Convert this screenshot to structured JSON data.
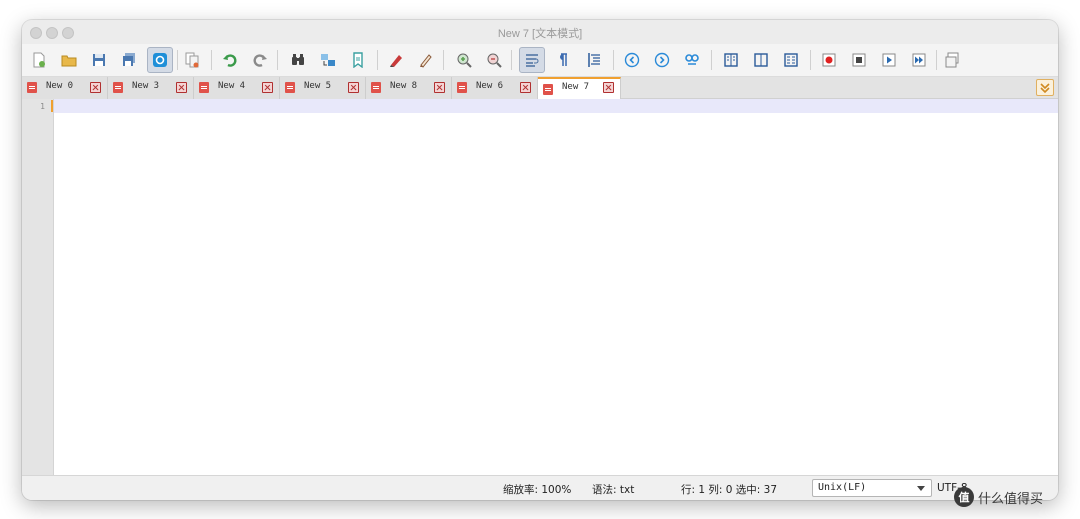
{
  "window": {
    "title": "New 7 [文本模式]"
  },
  "toolbar": {
    "buttons": [
      {
        "icon": "new-file-icon",
        "color": "#6ab04c"
      },
      {
        "icon": "open-folder-icon",
        "color": "#e8b84a"
      },
      {
        "icon": "save-icon",
        "color": "#4a78b0"
      },
      {
        "icon": "save-all-icon",
        "color": "#4a78b0"
      },
      {
        "icon": "toggle-active-icon",
        "color": "#1f8fd8",
        "active": true
      },
      {
        "icon": "copy-file-icon",
        "color": "#9a9a9a"
      },
      {
        "icon": "undo-icon",
        "color": "#3a9a4a"
      },
      {
        "icon": "redo-icon",
        "color": "#8a8a8a"
      },
      {
        "icon": "find-icon",
        "color": "#444444"
      },
      {
        "icon": "replace-icon",
        "color": "#3a88c8"
      },
      {
        "icon": "bookmark-icon",
        "color": "#3aa0a0"
      },
      {
        "icon": "highlight-icon",
        "color": "#c83a3a"
      },
      {
        "icon": "clear-highlight-icon",
        "color": "#8a5a3a"
      },
      {
        "icon": "zoom-in-icon",
        "color": "#5aa050"
      },
      {
        "icon": "zoom-out-icon",
        "color": "#c05050"
      },
      {
        "icon": "word-wrap-icon",
        "color": "#4a70a0",
        "active": true
      },
      {
        "icon": "show-symbols-icon",
        "color": "#3a6ab0"
      },
      {
        "icon": "indent-guide-icon",
        "color": "#2a5a9a"
      },
      {
        "icon": "previous-icon",
        "color": "#2a8ad8"
      },
      {
        "icon": "next-icon",
        "color": "#2a8ad8"
      },
      {
        "icon": "sync-scroll-icon",
        "color": "#2a8ad8"
      },
      {
        "icon": "split-horizontal-icon",
        "color": "#2a5a9a"
      },
      {
        "icon": "split-vertical-icon",
        "color": "#2a5a9a"
      },
      {
        "icon": "compare-icon",
        "color": "#2a5a9a"
      },
      {
        "icon": "record-macro-icon",
        "color": "#e02020"
      },
      {
        "icon": "stop-macro-icon",
        "color": "#444444"
      },
      {
        "icon": "play-macro-icon",
        "color": "#2a6ab0"
      },
      {
        "icon": "run-macro-multiple-icon",
        "color": "#2a6ab0"
      },
      {
        "icon": "save-macro-icon",
        "color": "#8a8a8a"
      }
    ]
  },
  "tabs": [
    {
      "label": "New 0",
      "active": false
    },
    {
      "label": "New 3",
      "active": false
    },
    {
      "label": "New 4",
      "active": false
    },
    {
      "label": "New 5",
      "active": false
    },
    {
      "label": "New 8",
      "active": false
    },
    {
      "label": "New 6",
      "active": false
    },
    {
      "label": "New 7",
      "active": true
    }
  ],
  "editor": {
    "line_numbers": [
      "1"
    ]
  },
  "statusbar": {
    "zoom": "缩放率: 100%",
    "syntax": "语法: txt",
    "position": "行: 1 列: 0 选中: 37",
    "eol": "Unix(LF)",
    "encoding": "UTF-8"
  },
  "watermark": {
    "logo": "值",
    "text": "什么值得买"
  },
  "colors": {
    "accent_tab": "#f0a030",
    "current_line": "#e8e8fa",
    "close_red": "#b03030"
  }
}
